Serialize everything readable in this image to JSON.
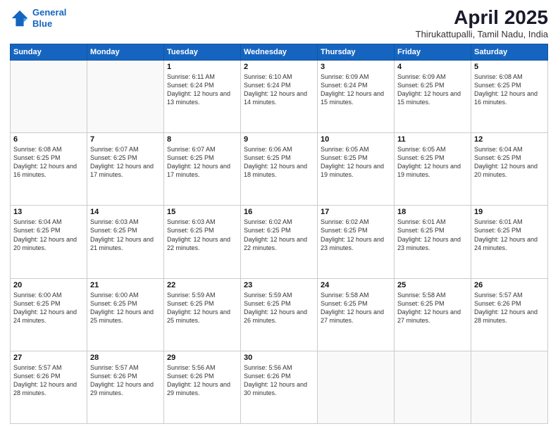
{
  "logo": {
    "line1": "General",
    "line2": "Blue"
  },
  "title": "April 2025",
  "subtitle": "Thirukattupalli, Tamil Nadu, India",
  "days_of_week": [
    "Sunday",
    "Monday",
    "Tuesday",
    "Wednesday",
    "Thursday",
    "Friday",
    "Saturday"
  ],
  "weeks": [
    [
      {
        "day": "",
        "info": ""
      },
      {
        "day": "",
        "info": ""
      },
      {
        "day": "1",
        "info": "Sunrise: 6:11 AM\nSunset: 6:24 PM\nDaylight: 12 hours\nand 13 minutes."
      },
      {
        "day": "2",
        "info": "Sunrise: 6:10 AM\nSunset: 6:24 PM\nDaylight: 12 hours\nand 14 minutes."
      },
      {
        "day": "3",
        "info": "Sunrise: 6:09 AM\nSunset: 6:24 PM\nDaylight: 12 hours\nand 15 minutes."
      },
      {
        "day": "4",
        "info": "Sunrise: 6:09 AM\nSunset: 6:25 PM\nDaylight: 12 hours\nand 15 minutes."
      },
      {
        "day": "5",
        "info": "Sunrise: 6:08 AM\nSunset: 6:25 PM\nDaylight: 12 hours\nand 16 minutes."
      }
    ],
    [
      {
        "day": "6",
        "info": "Sunrise: 6:08 AM\nSunset: 6:25 PM\nDaylight: 12 hours\nand 16 minutes."
      },
      {
        "day": "7",
        "info": "Sunrise: 6:07 AM\nSunset: 6:25 PM\nDaylight: 12 hours\nand 17 minutes."
      },
      {
        "day": "8",
        "info": "Sunrise: 6:07 AM\nSunset: 6:25 PM\nDaylight: 12 hours\nand 17 minutes."
      },
      {
        "day": "9",
        "info": "Sunrise: 6:06 AM\nSunset: 6:25 PM\nDaylight: 12 hours\nand 18 minutes."
      },
      {
        "day": "10",
        "info": "Sunrise: 6:05 AM\nSunset: 6:25 PM\nDaylight: 12 hours\nand 19 minutes."
      },
      {
        "day": "11",
        "info": "Sunrise: 6:05 AM\nSunset: 6:25 PM\nDaylight: 12 hours\nand 19 minutes."
      },
      {
        "day": "12",
        "info": "Sunrise: 6:04 AM\nSunset: 6:25 PM\nDaylight: 12 hours\nand 20 minutes."
      }
    ],
    [
      {
        "day": "13",
        "info": "Sunrise: 6:04 AM\nSunset: 6:25 PM\nDaylight: 12 hours\nand 20 minutes."
      },
      {
        "day": "14",
        "info": "Sunrise: 6:03 AM\nSunset: 6:25 PM\nDaylight: 12 hours\nand 21 minutes."
      },
      {
        "day": "15",
        "info": "Sunrise: 6:03 AM\nSunset: 6:25 PM\nDaylight: 12 hours\nand 22 minutes."
      },
      {
        "day": "16",
        "info": "Sunrise: 6:02 AM\nSunset: 6:25 PM\nDaylight: 12 hours\nand 22 minutes."
      },
      {
        "day": "17",
        "info": "Sunrise: 6:02 AM\nSunset: 6:25 PM\nDaylight: 12 hours\nand 23 minutes."
      },
      {
        "day": "18",
        "info": "Sunrise: 6:01 AM\nSunset: 6:25 PM\nDaylight: 12 hours\nand 23 minutes."
      },
      {
        "day": "19",
        "info": "Sunrise: 6:01 AM\nSunset: 6:25 PM\nDaylight: 12 hours\nand 24 minutes."
      }
    ],
    [
      {
        "day": "20",
        "info": "Sunrise: 6:00 AM\nSunset: 6:25 PM\nDaylight: 12 hours\nand 24 minutes."
      },
      {
        "day": "21",
        "info": "Sunrise: 6:00 AM\nSunset: 6:25 PM\nDaylight: 12 hours\nand 25 minutes."
      },
      {
        "day": "22",
        "info": "Sunrise: 5:59 AM\nSunset: 6:25 PM\nDaylight: 12 hours\nand 25 minutes."
      },
      {
        "day": "23",
        "info": "Sunrise: 5:59 AM\nSunset: 6:25 PM\nDaylight: 12 hours\nand 26 minutes."
      },
      {
        "day": "24",
        "info": "Sunrise: 5:58 AM\nSunset: 6:25 PM\nDaylight: 12 hours\nand 27 minutes."
      },
      {
        "day": "25",
        "info": "Sunrise: 5:58 AM\nSunset: 6:25 PM\nDaylight: 12 hours\nand 27 minutes."
      },
      {
        "day": "26",
        "info": "Sunrise: 5:57 AM\nSunset: 6:26 PM\nDaylight: 12 hours\nand 28 minutes."
      }
    ],
    [
      {
        "day": "27",
        "info": "Sunrise: 5:57 AM\nSunset: 6:26 PM\nDaylight: 12 hours\nand 28 minutes."
      },
      {
        "day": "28",
        "info": "Sunrise: 5:57 AM\nSunset: 6:26 PM\nDaylight: 12 hours\nand 29 minutes."
      },
      {
        "day": "29",
        "info": "Sunrise: 5:56 AM\nSunset: 6:26 PM\nDaylight: 12 hours\nand 29 minutes."
      },
      {
        "day": "30",
        "info": "Sunrise: 5:56 AM\nSunset: 6:26 PM\nDaylight: 12 hours\nand 30 minutes."
      },
      {
        "day": "",
        "info": ""
      },
      {
        "day": "",
        "info": ""
      },
      {
        "day": "",
        "info": ""
      }
    ]
  ]
}
